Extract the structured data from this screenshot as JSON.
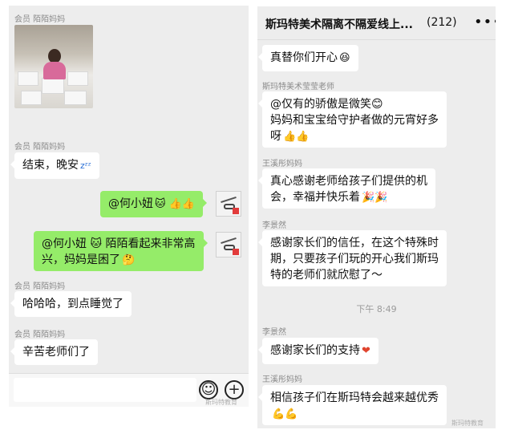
{
  "left_chat": {
    "messages": [
      {
        "sender": "会员 陌陌妈妈",
        "type": "image"
      },
      {
        "sender": "会员 陌陌妈妈",
        "text": "结束，晚安",
        "emoji": "zᶻᶻ"
      },
      {
        "sender": "",
        "text": "@何小妞",
        "emoji": "🐱 👍👍",
        "mine": true
      },
      {
        "sender": "",
        "line1": "@何小妞 🐱 陌陌看起来非常高",
        "line2": "兴，妈妈是困了",
        "emoji": "🤔",
        "mine": true
      },
      {
        "sender": "会员 陌陌妈妈",
        "text": "哈哈哈，到点睡觉了"
      },
      {
        "sender": "会员 陌陌妈妈",
        "text": "辛苦老师们了"
      }
    ],
    "input_placeholder": "",
    "emoji_icon": "☺",
    "plus_icon": "+",
    "watermark": "斯玛特教育"
  },
  "right_chat": {
    "header": {
      "title": "斯玛特美术隔离不隔爱线上...",
      "count": "(212)",
      "more_icon": "•••"
    },
    "messages": [
      {
        "sender": "",
        "text": "真替你们开心",
        "emoji": "😆"
      },
      {
        "sender": "斯玛特美术莹莹老师",
        "line1": "@仅有的骄傲是微笑😊",
        "line2": "妈妈和宝宝给守护者做的元宵好多",
        "line3": "呀",
        "emoji": "👍👍"
      },
      {
        "sender": "王溪彤妈妈",
        "line1": "真心感谢老师给孩子们提供的机",
        "line2": "会，幸福并快乐着",
        "emoji": "🎉🎉"
      },
      {
        "sender": "李景然",
        "line1": "感谢家长们的信任，在这个特殊时",
        "line2": "期，只要孩子们玩的开心我们斯玛",
        "line3": "特的老师们就欣慰了～"
      },
      {
        "time": "下午 8:49"
      },
      {
        "sender": "李景然",
        "text": "感谢家长们的支持",
        "emoji": "❤"
      },
      {
        "sender": "王溪彤妈妈",
        "text": "相信孩子们在斯玛特会越来越优秀",
        "emoji": "💪💪"
      }
    ],
    "watermark": "斯玛特教育"
  }
}
